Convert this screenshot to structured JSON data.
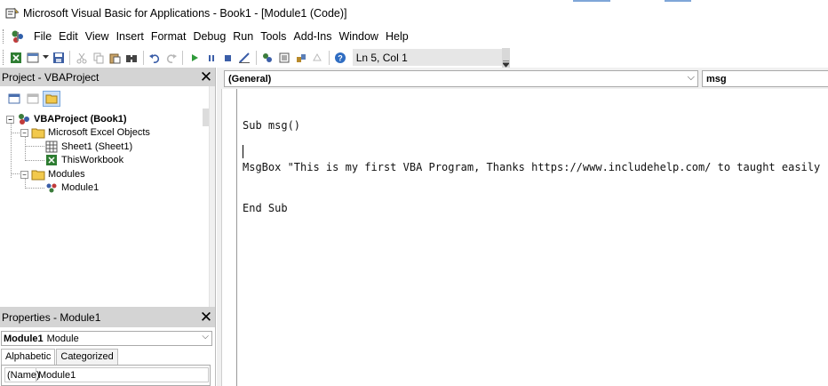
{
  "window": {
    "title": "Microsoft Visual Basic for Applications - Book1 - [Module1 (Code)]"
  },
  "menubar": {
    "items": [
      {
        "label": "File"
      },
      {
        "label": "Edit"
      },
      {
        "label": "View"
      },
      {
        "label": "Insert"
      },
      {
        "label": "Format"
      },
      {
        "label": "Debug"
      },
      {
        "label": "Run"
      },
      {
        "label": "Tools"
      },
      {
        "label": "Add-Ins"
      },
      {
        "label": "Window"
      },
      {
        "label": "Help"
      }
    ]
  },
  "toolbar": {
    "status": "Ln 5, Col 1"
  },
  "project": {
    "title": "Project - VBAProject",
    "close": "✕",
    "tree": [
      {
        "label": "VBAProject (Book1)"
      },
      {
        "label": "Microsoft Excel Objects"
      },
      {
        "label": "Sheet1 (Sheet1)"
      },
      {
        "label": "ThisWorkbook"
      },
      {
        "label": "Modules"
      },
      {
        "label": "Module1"
      }
    ]
  },
  "properties": {
    "title": "Properties - Module1",
    "close": "✕",
    "object_name": "Module1",
    "object_type": "Module",
    "tabs": [
      {
        "label": "Alphabetic"
      },
      {
        "label": "Categorized"
      }
    ],
    "row_key": "(Name)",
    "row_value": "Module1"
  },
  "code": {
    "object_dropdown": "(General)",
    "proc_dropdown": "msg",
    "lines": [
      "Sub msg()",
      "MsgBox \"This is my first VBA Program, Thanks https://www.includehelp.com/ to taught easily \"",
      "End Sub",
      ""
    ]
  },
  "colors": {
    "pane_header": "#d4d4d4",
    "active_tool": "#c9dff7"
  }
}
